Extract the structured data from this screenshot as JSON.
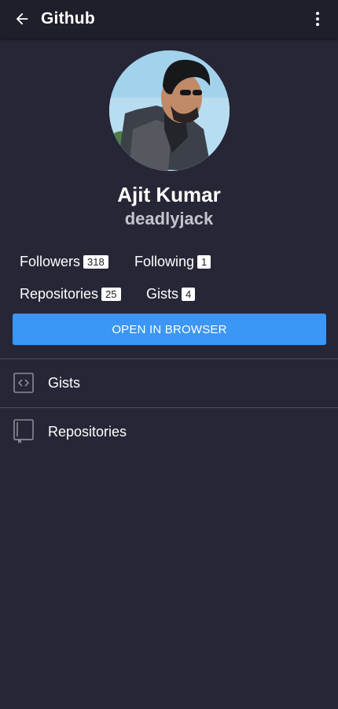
{
  "appbar": {
    "title": "Github",
    "back_icon": "arrow-left-icon",
    "menu_icon": "more-vertical-icon"
  },
  "profile": {
    "name": "Ajit Kumar",
    "username": "deadlyjack"
  },
  "stats": {
    "followers": {
      "label": "Followers",
      "count": "318"
    },
    "following": {
      "label": "Following",
      "count": "1"
    },
    "repositories": {
      "label": "Repositories",
      "count": "25"
    },
    "gists": {
      "label": "Gists",
      "count": "4"
    }
  },
  "open_button": {
    "label": "OPEN IN BROWSER"
  },
  "list": [
    {
      "label": "Gists",
      "icon": "code-icon"
    },
    {
      "label": "Repositories",
      "icon": "book-icon"
    }
  ],
  "colors": {
    "background": "#262636",
    "appbar": "#1f1f2c",
    "accent": "#3b96f5",
    "divider": "#4c4c5c"
  }
}
